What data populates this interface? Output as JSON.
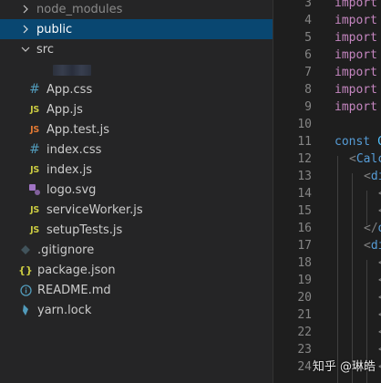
{
  "explorer": {
    "items": [
      {
        "label": "node_modules",
        "kind": "folder",
        "expanded": false,
        "dim": true
      },
      {
        "label": "public",
        "kind": "folder",
        "expanded": false,
        "selected": true
      },
      {
        "label": "src",
        "kind": "folder",
        "expanded": true
      },
      {
        "label": "App.css",
        "kind": "css",
        "icon": "#"
      },
      {
        "label": "App.js",
        "kind": "js",
        "icon": "JS"
      },
      {
        "label": "App.test.js",
        "kind": "test",
        "icon": "JS"
      },
      {
        "label": "index.css",
        "kind": "css",
        "icon": "#"
      },
      {
        "label": "index.js",
        "kind": "js",
        "icon": "JS"
      },
      {
        "label": "logo.svg",
        "kind": "svg",
        "icon": "svg-icon"
      },
      {
        "label": "serviceWorker.js",
        "kind": "js",
        "icon": "JS"
      },
      {
        "label": "setupTests.js",
        "kind": "js",
        "icon": "JS"
      },
      {
        "label": ".gitignore",
        "kind": "git",
        "icon": "◆"
      },
      {
        "label": "package.json",
        "kind": "json",
        "icon": "{ }"
      },
      {
        "label": "README.md",
        "kind": "info",
        "icon": "ⓘ"
      },
      {
        "label": "yarn.lock",
        "kind": "yarn",
        "icon": "yarn-icon"
      }
    ]
  },
  "editor": {
    "lines": [
      {
        "n": "3",
        "text": "import"
      },
      {
        "n": "4",
        "text": "import"
      },
      {
        "n": "5",
        "text": "import"
      },
      {
        "n": "6",
        "text": "import"
      },
      {
        "n": "7",
        "text": "import"
      },
      {
        "n": "8",
        "text": "import"
      },
      {
        "n": "9",
        "text": "import"
      },
      {
        "n": "10",
        "text": ""
      },
      {
        "n": "11",
        "text": "const C"
      },
      {
        "n": "12",
        "text": "<Calc"
      },
      {
        "n": "13",
        "text": "<di"
      },
      {
        "n": "14",
        "text": "<"
      },
      {
        "n": "15",
        "text": "<"
      },
      {
        "n": "16",
        "text": "</d"
      },
      {
        "n": "17",
        "text": "<di"
      },
      {
        "n": "18",
        "text": "<"
      },
      {
        "n": "19",
        "text": "<"
      },
      {
        "n": "20",
        "text": "<"
      },
      {
        "n": "21",
        "text": "<"
      },
      {
        "n": "22",
        "text": "<"
      },
      {
        "n": "23",
        "text": "<"
      },
      {
        "n": "24",
        "text": "<"
      }
    ]
  },
  "watermark": "知乎 @琳皓"
}
